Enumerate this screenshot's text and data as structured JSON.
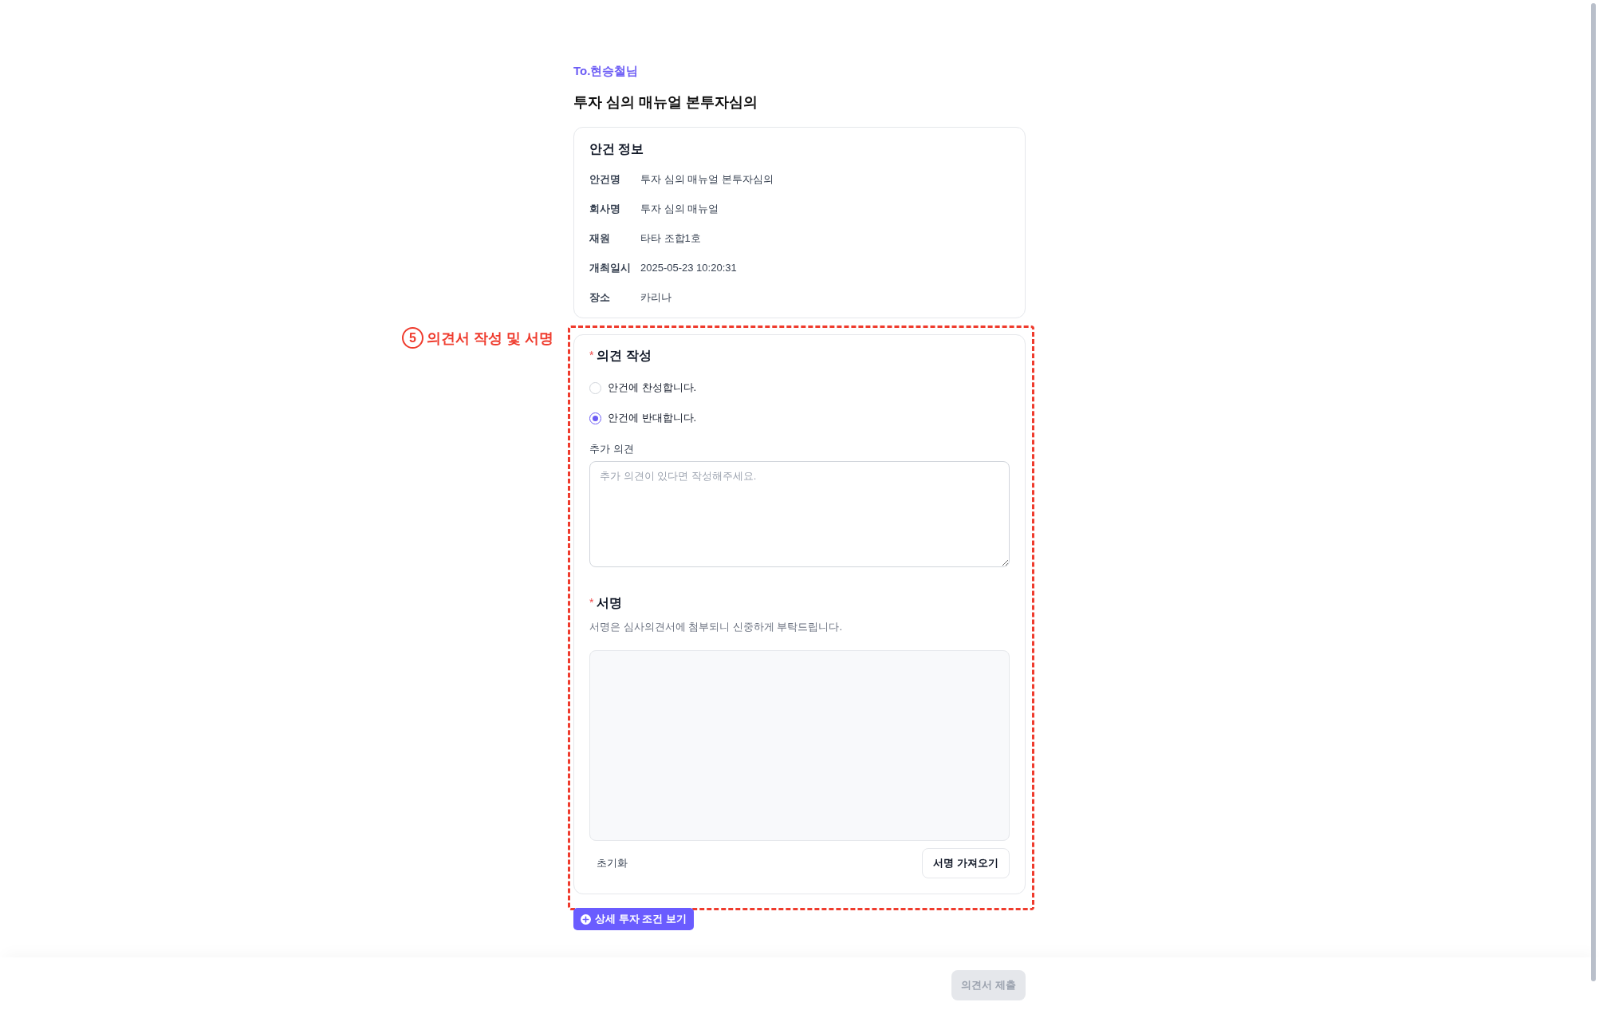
{
  "recipient": "To.현승철님",
  "title": "투자 심의 매뉴얼 본투자심의",
  "agenda_info": {
    "heading": "안건 정보",
    "rows": [
      {
        "label": "안건명",
        "value": "투자 심의 매뉴얼 본투자심의"
      },
      {
        "label": "회사명",
        "value": "투자 심의 매뉴얼"
      },
      {
        "label": "재원",
        "value": "타타 조합1호"
      },
      {
        "label": "개최일시",
        "value": "2025-05-23 10:20:31"
      },
      {
        "label": "장소",
        "value": "카리나"
      }
    ]
  },
  "annotation": {
    "number": "5",
    "label": "의견서 작성 및 서명"
  },
  "opinion": {
    "required_mark": "*",
    "heading": "의견 작성",
    "options": [
      {
        "label": "안건에 찬성합니다.",
        "selected": false
      },
      {
        "label": "안건에 반대합니다.",
        "selected": true
      }
    ],
    "comment": {
      "label": "추가 의견",
      "placeholder": "추가 의견이 있다면 작성해주세요."
    }
  },
  "signature": {
    "required_mark": "*",
    "heading": "서명",
    "hint": "서명은 심사의견서에 첨부되니 신중하게 부탁드립니다.",
    "reset_button": "초기화",
    "import_button": "서명 가져오기"
  },
  "details_button": "상세 투자 조건 보기",
  "submit_button": {
    "label": "의견서 제출",
    "disabled": true
  }
}
